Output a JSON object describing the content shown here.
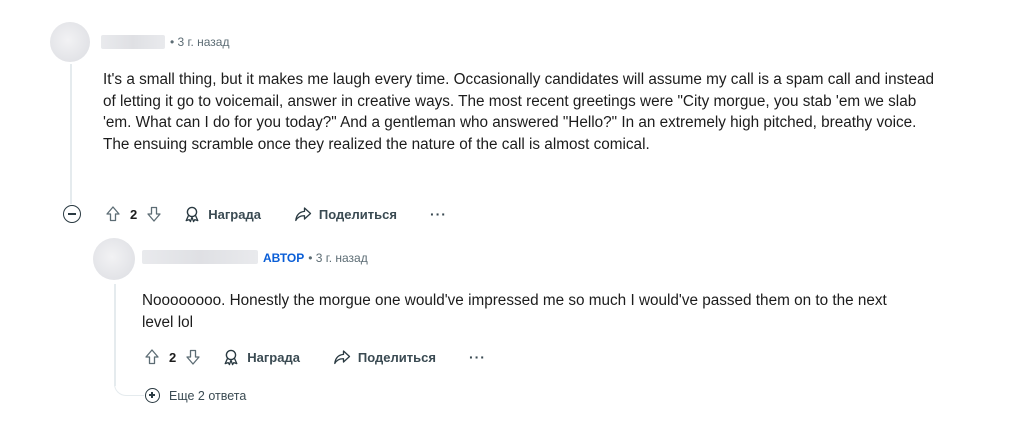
{
  "comments": [
    {
      "time": "3 г. назад",
      "body": "It's a small thing, but it makes me laugh every time. Occasionally candidates will assume my call is a spam call and instead of letting it go to voicemail, answer in creative ways. The most recent greetings were \"City morgue, you stab 'em we slab 'em. What can I do for you today?\" And a gentleman who answered \"Hello?\" In an extremely high pitched, breathy voice. The ensuing scramble once they realized the nature of the call is almost comical.",
      "votes": "2",
      "award_label": "Награда",
      "share_label": "Поделиться",
      "more_label": "···"
    },
    {
      "author_badge": "АВТОР",
      "time": "3 г. назад",
      "body": "Noooooooo. Honestly the morgue one would've impressed me so much I would've passed them on to the next level lol",
      "votes": "2",
      "award_label": "Награда",
      "share_label": "Поделиться",
      "more_label": "···"
    }
  ],
  "more_replies_label": "Еще 2 ответа",
  "separator": "•",
  "icons": {
    "upvote": "arrow-up-outline-icon",
    "downvote": "arrow-down-outline-icon",
    "award": "award-ribbon-icon",
    "share": "share-arrow-icon",
    "collapse": "minus-circle-icon",
    "expand": "plus-circle-icon"
  },
  "colors": {
    "author_badge": "#0a5ed7",
    "meta_text": "#5c6c74",
    "thread_line": "#e5ebee"
  }
}
